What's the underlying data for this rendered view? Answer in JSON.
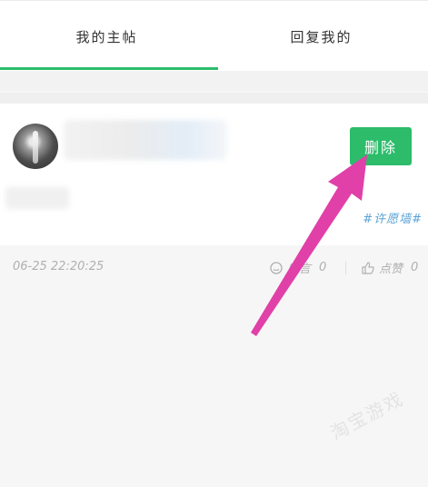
{
  "tabs": [
    {
      "label": "我的主帖",
      "active": true
    },
    {
      "label": "回复我的",
      "active": false
    }
  ],
  "post": {
    "delete_label": "删除",
    "tag": "#许愿墙#",
    "timestamp": "06-25  22:20:25",
    "comment_label": "留言",
    "comment_count": "0",
    "like_label": "点赞",
    "like_count": "0"
  },
  "watermark": "淘宝游戏",
  "colors": {
    "accent": "#2cbc6a",
    "arrow": "#e040a8",
    "tag": "#5aa3d8"
  }
}
